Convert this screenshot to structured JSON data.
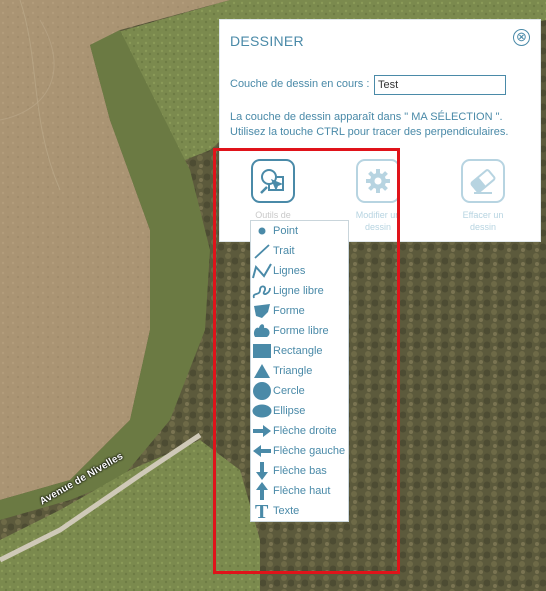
{
  "map": {
    "road_label": "Avenue de Nivelles",
    "colors": {
      "field": "#a99372",
      "grass": "#7d8a4f",
      "forest": "#5b5c3a",
      "road": "#d6d2c6"
    }
  },
  "panel": {
    "title": "DESSINER",
    "close_icon": "⊗",
    "layer_label": "Couche de dessin en cours :",
    "layer_value": "Test",
    "info_line1": "La couche de dessin apparaît dans \" MA SÉLECTION \".",
    "info_line2": "Utilisez la touche CTRL pour tracer des perpendiculaires.",
    "tools": [
      {
        "label": "Outils de dessin",
        "icon": "draw-tools-icon"
      },
      {
        "label": "Modifier un dessin",
        "icon": "gear-icon"
      },
      {
        "label": "Effacer un dessin",
        "icon": "eraser-icon"
      }
    ],
    "accent_color": "#4a8aa8"
  },
  "menu": {
    "items": [
      {
        "label": "Point",
        "icon": "point-icon"
      },
      {
        "label": "Trait",
        "icon": "line-icon"
      },
      {
        "label": "Lignes",
        "icon": "polyline-icon"
      },
      {
        "label": "Ligne libre",
        "icon": "freehand-line-icon"
      },
      {
        "label": "Forme",
        "icon": "shape-icon"
      },
      {
        "label": "Forme libre",
        "icon": "freehand-shape-icon"
      },
      {
        "label": "Rectangle",
        "icon": "rectangle-icon"
      },
      {
        "label": "Triangle",
        "icon": "triangle-icon"
      },
      {
        "label": "Cercle",
        "icon": "circle-icon"
      },
      {
        "label": "Ellipse",
        "icon": "ellipse-icon"
      },
      {
        "label": "Flèche droite",
        "icon": "arrow-right-icon"
      },
      {
        "label": "Flèche gauche",
        "icon": "arrow-left-icon"
      },
      {
        "label": "Flèche bas",
        "icon": "arrow-down-icon"
      },
      {
        "label": "Flèche haut",
        "icon": "arrow-up-icon"
      },
      {
        "label": "Texte",
        "icon": "text-icon"
      }
    ]
  },
  "annotation": {
    "highlight_color": "#e0131a"
  }
}
